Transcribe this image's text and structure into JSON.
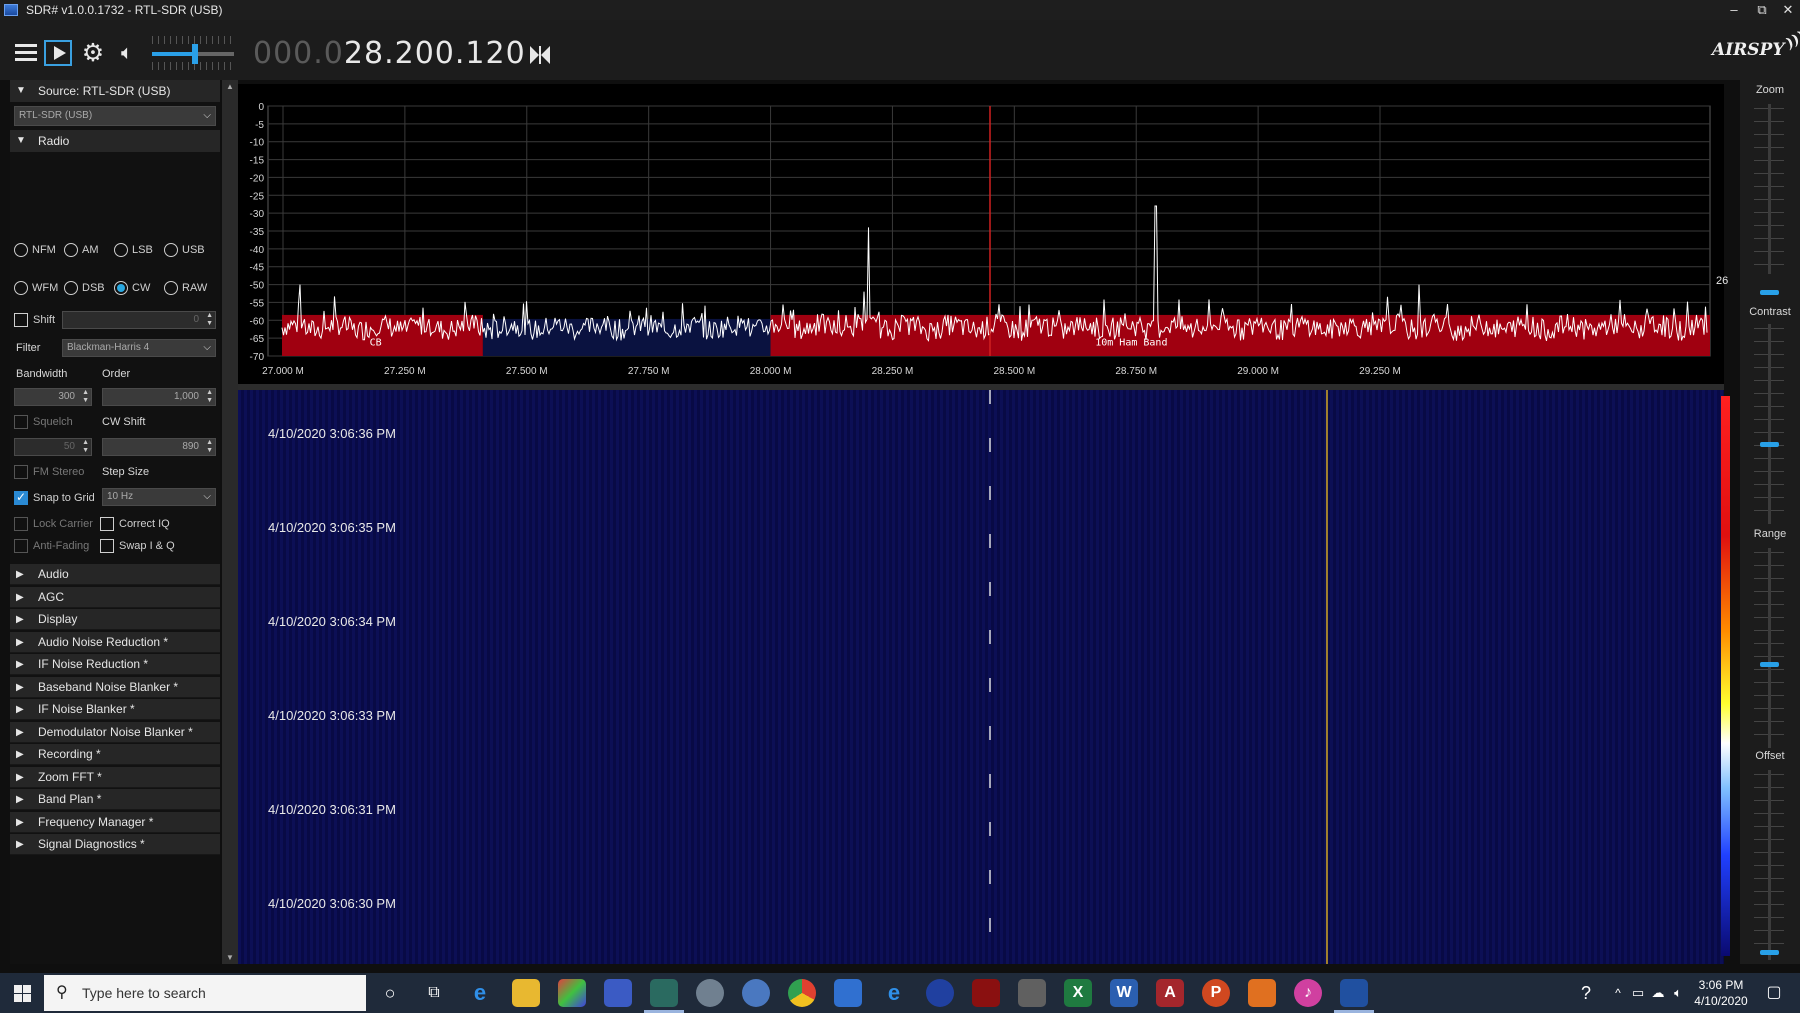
{
  "titlebar": {
    "title": "SDR# v1.0.0.1732 - RTL-SDR (USB)",
    "minimize": "–",
    "restore": "⧉",
    "close": "✕"
  },
  "toolbar": {
    "frequency_dim": "000.0",
    "frequency_bright": "28.200.120",
    "logo": "AIRSPY",
    "volume_level": 0.52
  },
  "left_panel": {
    "source_header": "Source: RTL-SDR (USB)",
    "source_device": "RTL-SDR (USB)",
    "radio_header": "Radio",
    "modes_row1": [
      "NFM",
      "AM",
      "LSB",
      "USB"
    ],
    "modes_row2": [
      "WFM",
      "DSB",
      "CW",
      "RAW"
    ],
    "selected_mode": "CW",
    "shift_label": "Shift",
    "shift_value": "0",
    "filter_label": "Filter",
    "filter_value": "Blackman-Harris 4",
    "bandwidth_label": "Bandwidth",
    "bandwidth_value": "300",
    "order_label": "Order",
    "order_value": "1,000",
    "squelch_label": "Squelch",
    "squelch_value": "50",
    "cw_shift_label": "CW Shift",
    "cw_shift_value": "890",
    "fm_stereo_label": "FM Stereo",
    "step_size_label": "Step Size",
    "snap_to_grid_label": "Snap to Grid",
    "step_size_value": "10 Hz",
    "lock_carrier_label": "Lock Carrier",
    "correct_iq_label": "Correct IQ",
    "anti_fading_label": "Anti-Fading",
    "swap_iq_label": "Swap I & Q",
    "sections": [
      "Audio",
      "AGC",
      "Display",
      "Audio Noise Reduction *",
      "IF Noise Reduction *",
      "Baseband Noise Blanker *",
      "IF Noise Blanker *",
      "Demodulator Noise Blanker *",
      "Recording *",
      "Zoom FFT *",
      "Band Plan *",
      "Frequency Manager *",
      "Signal Diagnostics *"
    ]
  },
  "spectrum": {
    "y_ticks": [
      "0",
      "-5",
      "-10",
      "-15",
      "-20",
      "-25",
      "-30",
      "-35",
      "-40",
      "-45",
      "-50",
      "-55",
      "-60",
      "-65",
      "-70"
    ],
    "x_ticks": [
      "27.000 M",
      "27.250 M",
      "27.500 M",
      "27.750 M",
      "28.000 M",
      "28.250 M",
      "28.500 M",
      "28.750 M",
      "29.000 M",
      "29.250 M"
    ],
    "band_cb": "CB",
    "band_10m": "10m Ham Band",
    "range_value": "26"
  },
  "waterfall": {
    "timestamps": [
      "4/10/2020 3:06:36 PM",
      "4/10/2020 3:06:35 PM",
      "4/10/2020 3:06:34 PM",
      "4/10/2020 3:06:33 PM",
      "4/10/2020 3:06:31 PM",
      "4/10/2020 3:06:30 PM"
    ]
  },
  "right_panel": {
    "zoom": "Zoom",
    "contrast": "Contrast",
    "range": "Range",
    "offset": "Offset"
  },
  "taskbar": {
    "search_placeholder": "Type here to search",
    "time": "3:06 PM",
    "date": "4/10/2020"
  },
  "colors": {
    "accent": "#28a0e8",
    "band_fill": "#a00010",
    "spectrum_line": "#ffffff",
    "waterfall_bg": "#0a0c4a",
    "tuning_line": "#d02020",
    "carrier_line": "#e0b020"
  }
}
